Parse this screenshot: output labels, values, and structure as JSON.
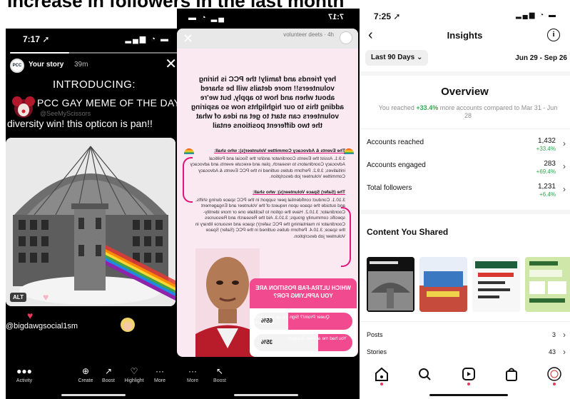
{
  "headline": "Increase in followers in the last month",
  "story": {
    "time": "7:17",
    "progress": 0.35,
    "username": "Your story",
    "ago": "39m",
    "intro": "INTRODUCING:",
    "meme_title": "PCC GAY MEME OF THE DAY",
    "meme_handle": "@SeeMyScissors",
    "caption": "diversity win! this opticon is pan!!",
    "alt": "ALT",
    "mention": "@bigdawgsocial1sm",
    "bar": {
      "activity": "Activity",
      "create": "Create",
      "boost": "Boost",
      "highlight": "Highlight",
      "more": "More"
    }
  },
  "story2": {
    "time": "7:17",
    "username": "volunteer deets",
    "ago": "4h",
    "heading": "hey friends and family! the PCC is hiring volunteers!! more details will be shared about when and how to apply, but we're adding this to our highlights now so aspiring volunteers can start to get an idea of what the two different positions entail",
    "block1_hdr": "The Events & Advocacy Committee Volunteer(s): who shall:",
    "block1_body": "3.9.1. Assist the Events Coordinator and/or the Social and Political Advocacy Coordinators to research, plan and execute events and advocacy initiatives; 3.9.2. Perform duties outlined in the PCC Events & Advocacy Committee Volunteer job description.",
    "block2_hdr": "The (Safer) Space Volunteer(s): who shall:",
    "block2_body": "3.10.1. Conduct confidential peer support in the PCC space during shifts, and outside the space upon request of the Volunteer and Engagement Coordinator; 3.10.2. Have the option to facilitate one or more identity-specific community groups; 3.10.3. Aid the Research and Resources Coordinator in maintaining the PCC safer(r) space and resource library in the space; 3.10.4. Perform duties outlined in the PCC (Safer) Space Volunteer job description.",
    "poll_question": "WHICH ULTRA-FAB POSITION ARE YOU APPLYING FOR?",
    "poll_options": [
      {
        "label": "Queer Prom!? Sign me up for events volunteer!",
        "pct": "65",
        "value": 0.65
      },
      {
        "label": "You had me at Peer Support",
        "pct": "35",
        "value": 0.35
      }
    ],
    "bar": {
      "more": "More",
      "boost": "Boost"
    }
  },
  "insights": {
    "time": "7:25",
    "title": "Insights",
    "range": "Last 90 Days",
    "dates": "Jun 29 - Sep 26",
    "overview_title": "Overview",
    "reach_prefix": "You reached ",
    "reach_pct": "+33.4%",
    "reach_suffix": " more accounts compared to Mar 31 - Jun 28",
    "metrics": [
      {
        "label": "Accounts reached",
        "value": "1,432",
        "change": "+33.4%"
      },
      {
        "label": "Accounts engaged",
        "value": "283",
        "change": "+69.4%"
      },
      {
        "label": "Total followers",
        "value": "1,231",
        "change": "+6.4%"
      }
    ],
    "content_title": "Content You Shared",
    "rows": [
      {
        "label": "Posts",
        "value": "3"
      },
      {
        "label": "Stories",
        "value": "43"
      }
    ],
    "colors": {
      "accent_green": "#2fa84f",
      "poll_pink": "#f14a8e"
    }
  }
}
